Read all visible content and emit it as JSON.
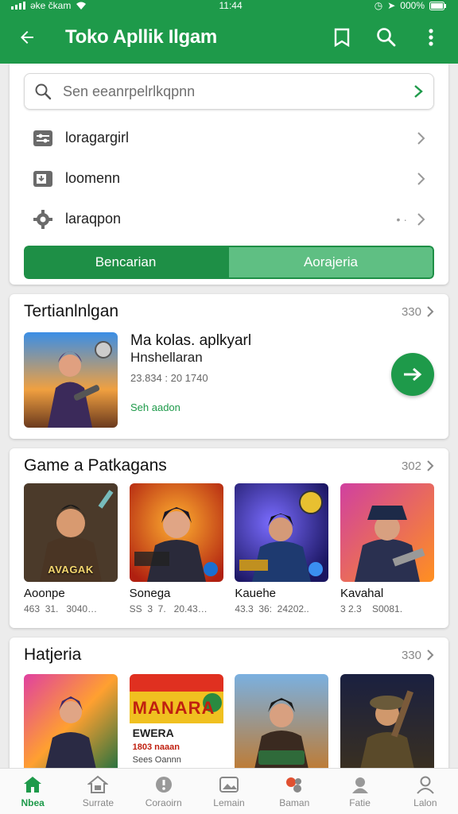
{
  "status": {
    "left_text": "əke čkam",
    "time": "11:44",
    "battery": "000%"
  },
  "appbar": {
    "title": "Toko Apllik Ilgam",
    "icons": [
      "back-arrow-icon",
      "bookmark-icon",
      "search-icon",
      "more-vert-icon"
    ]
  },
  "search": {
    "placeholder": "Sen eeanrpelrlkqpnn",
    "items": [
      {
        "label": "loragargirl",
        "icon": "settings-sliders-icon"
      },
      {
        "label": "loomenn",
        "icon": "download-tray-icon"
      },
      {
        "label": "laraqpon",
        "icon": "gear-icon"
      }
    ],
    "segment": {
      "left": "Bencarian",
      "right": "Aorajeria"
    }
  },
  "featured": {
    "title": "Tertianlnlgan",
    "more": "330",
    "app": {
      "name": "Ma kolas. aplkyarl",
      "sub": "Hnshellaran",
      "meta": "23.834 : 20 1740",
      "tag": "Seh aadon"
    }
  },
  "games": {
    "title": "Game a Patkagans",
    "more": "302",
    "items": [
      {
        "name": "Aoonpe",
        "meta": "463  31.   3040…",
        "art_text": "AVAGAK"
      },
      {
        "name": "Sonega",
        "meta": "SS  3  7.   20.43…",
        "art_text": ""
      },
      {
        "name": "Kauehe",
        "meta": "43.3  36:  24202..",
        "art_text": ""
      },
      {
        "name": "Kavahal",
        "meta": "3 2.3    S0081.",
        "art_text": ""
      }
    ]
  },
  "categories": {
    "title": "Hatjeria",
    "more": "330",
    "items": [
      {
        "art_text": ""
      },
      {
        "art_text": "MANARA",
        "art_sub": "EWERA",
        "art_sub2": "1803 naaan",
        "art_sub3": "Sees Oannn"
      },
      {
        "art_text": ""
      },
      {
        "art_text": ""
      }
    ]
  },
  "bottomnav": [
    {
      "label": "Nbea",
      "icon": "home-icon",
      "active": true
    },
    {
      "label": "Surrate",
      "icon": "store-icon"
    },
    {
      "label": "Coraoirn",
      "icon": "compass-icon"
    },
    {
      "label": "Lemain",
      "icon": "photo-icon"
    },
    {
      "label": "Baman",
      "icon": "apps-icon"
    },
    {
      "label": "Fatie",
      "icon": "people-icon"
    },
    {
      "label": "Lalon",
      "icon": "account-icon"
    }
  ],
  "colors": {
    "brand": "#1e9a4a",
    "brand_dark": "#1e8f46",
    "brand_light": "#5fbf83"
  }
}
